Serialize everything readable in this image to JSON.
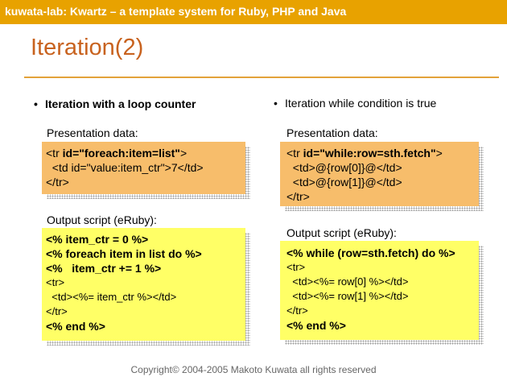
{
  "header": {
    "title": "kuwata-lab:  Kwartz – a template system for Ruby, PHP and Java"
  },
  "slide": {
    "title": "Iteration(2)"
  },
  "left": {
    "bullet": "Iteration with a loop counter",
    "presentation_label": "Presentation data:",
    "presentation_lines": [
      {
        "pre": "<tr ",
        "bold": "id=\"foreach:item=list\"",
        "post": ">"
      },
      {
        "pre": "  <td id=\"value:item_ctr\">7</td>",
        "bold": "",
        "post": ""
      },
      {
        "pre": "</tr>",
        "bold": "",
        "post": ""
      }
    ],
    "output_label": "Output script (eRuby):",
    "output_lines": [
      {
        "text": "<% item_ctr = 0 %>",
        "bold": true
      },
      {
        "text": "<% foreach item in list do %>",
        "bold": true
      },
      {
        "text": "<%   item_ctr += 1 %>",
        "bold": true
      },
      {
        "text": "<tr>",
        "bold": false
      },
      {
        "text": "  <td><%= item_ctr %></td>",
        "bold": false
      },
      {
        "text": "</tr>",
        "bold": false
      },
      {
        "text": "<% end %>",
        "bold": true
      }
    ]
  },
  "right": {
    "bullet": "Iteration while condition is true",
    "presentation_label": "Presentation data:",
    "presentation_lines": [
      {
        "pre": "<tr ",
        "bold": "id=\"while:row=sth.fetch\"",
        "post": ">"
      },
      {
        "pre": "  <td>@{row[0]}@</td>",
        "bold": "",
        "post": ""
      },
      {
        "pre": "  <td>@{row[1]}@</td>",
        "bold": "",
        "post": ""
      },
      {
        "pre": "</tr>",
        "bold": "",
        "post": ""
      }
    ],
    "output_label": "Output script (eRuby):",
    "output_lines": [
      {
        "text": "<% while (row=sth.fetch) do %>",
        "bold": true
      },
      {
        "text": "<tr>",
        "bold": false
      },
      {
        "text": "  <td><%= row[0] %></td>",
        "bold": false
      },
      {
        "text": "  <td><%= row[1] %></td>",
        "bold": false
      },
      {
        "text": "</tr>",
        "bold": false
      },
      {
        "text": "<% end %>",
        "bold": true
      }
    ]
  },
  "footer": {
    "copyright": "Copyright© 2004-2005 Makoto Kuwata all rights reserved"
  },
  "colors": {
    "header": "#e8a200",
    "title": "#c8621e",
    "presentation_box": "#f7bd6b",
    "output_box": "#ffff66"
  }
}
